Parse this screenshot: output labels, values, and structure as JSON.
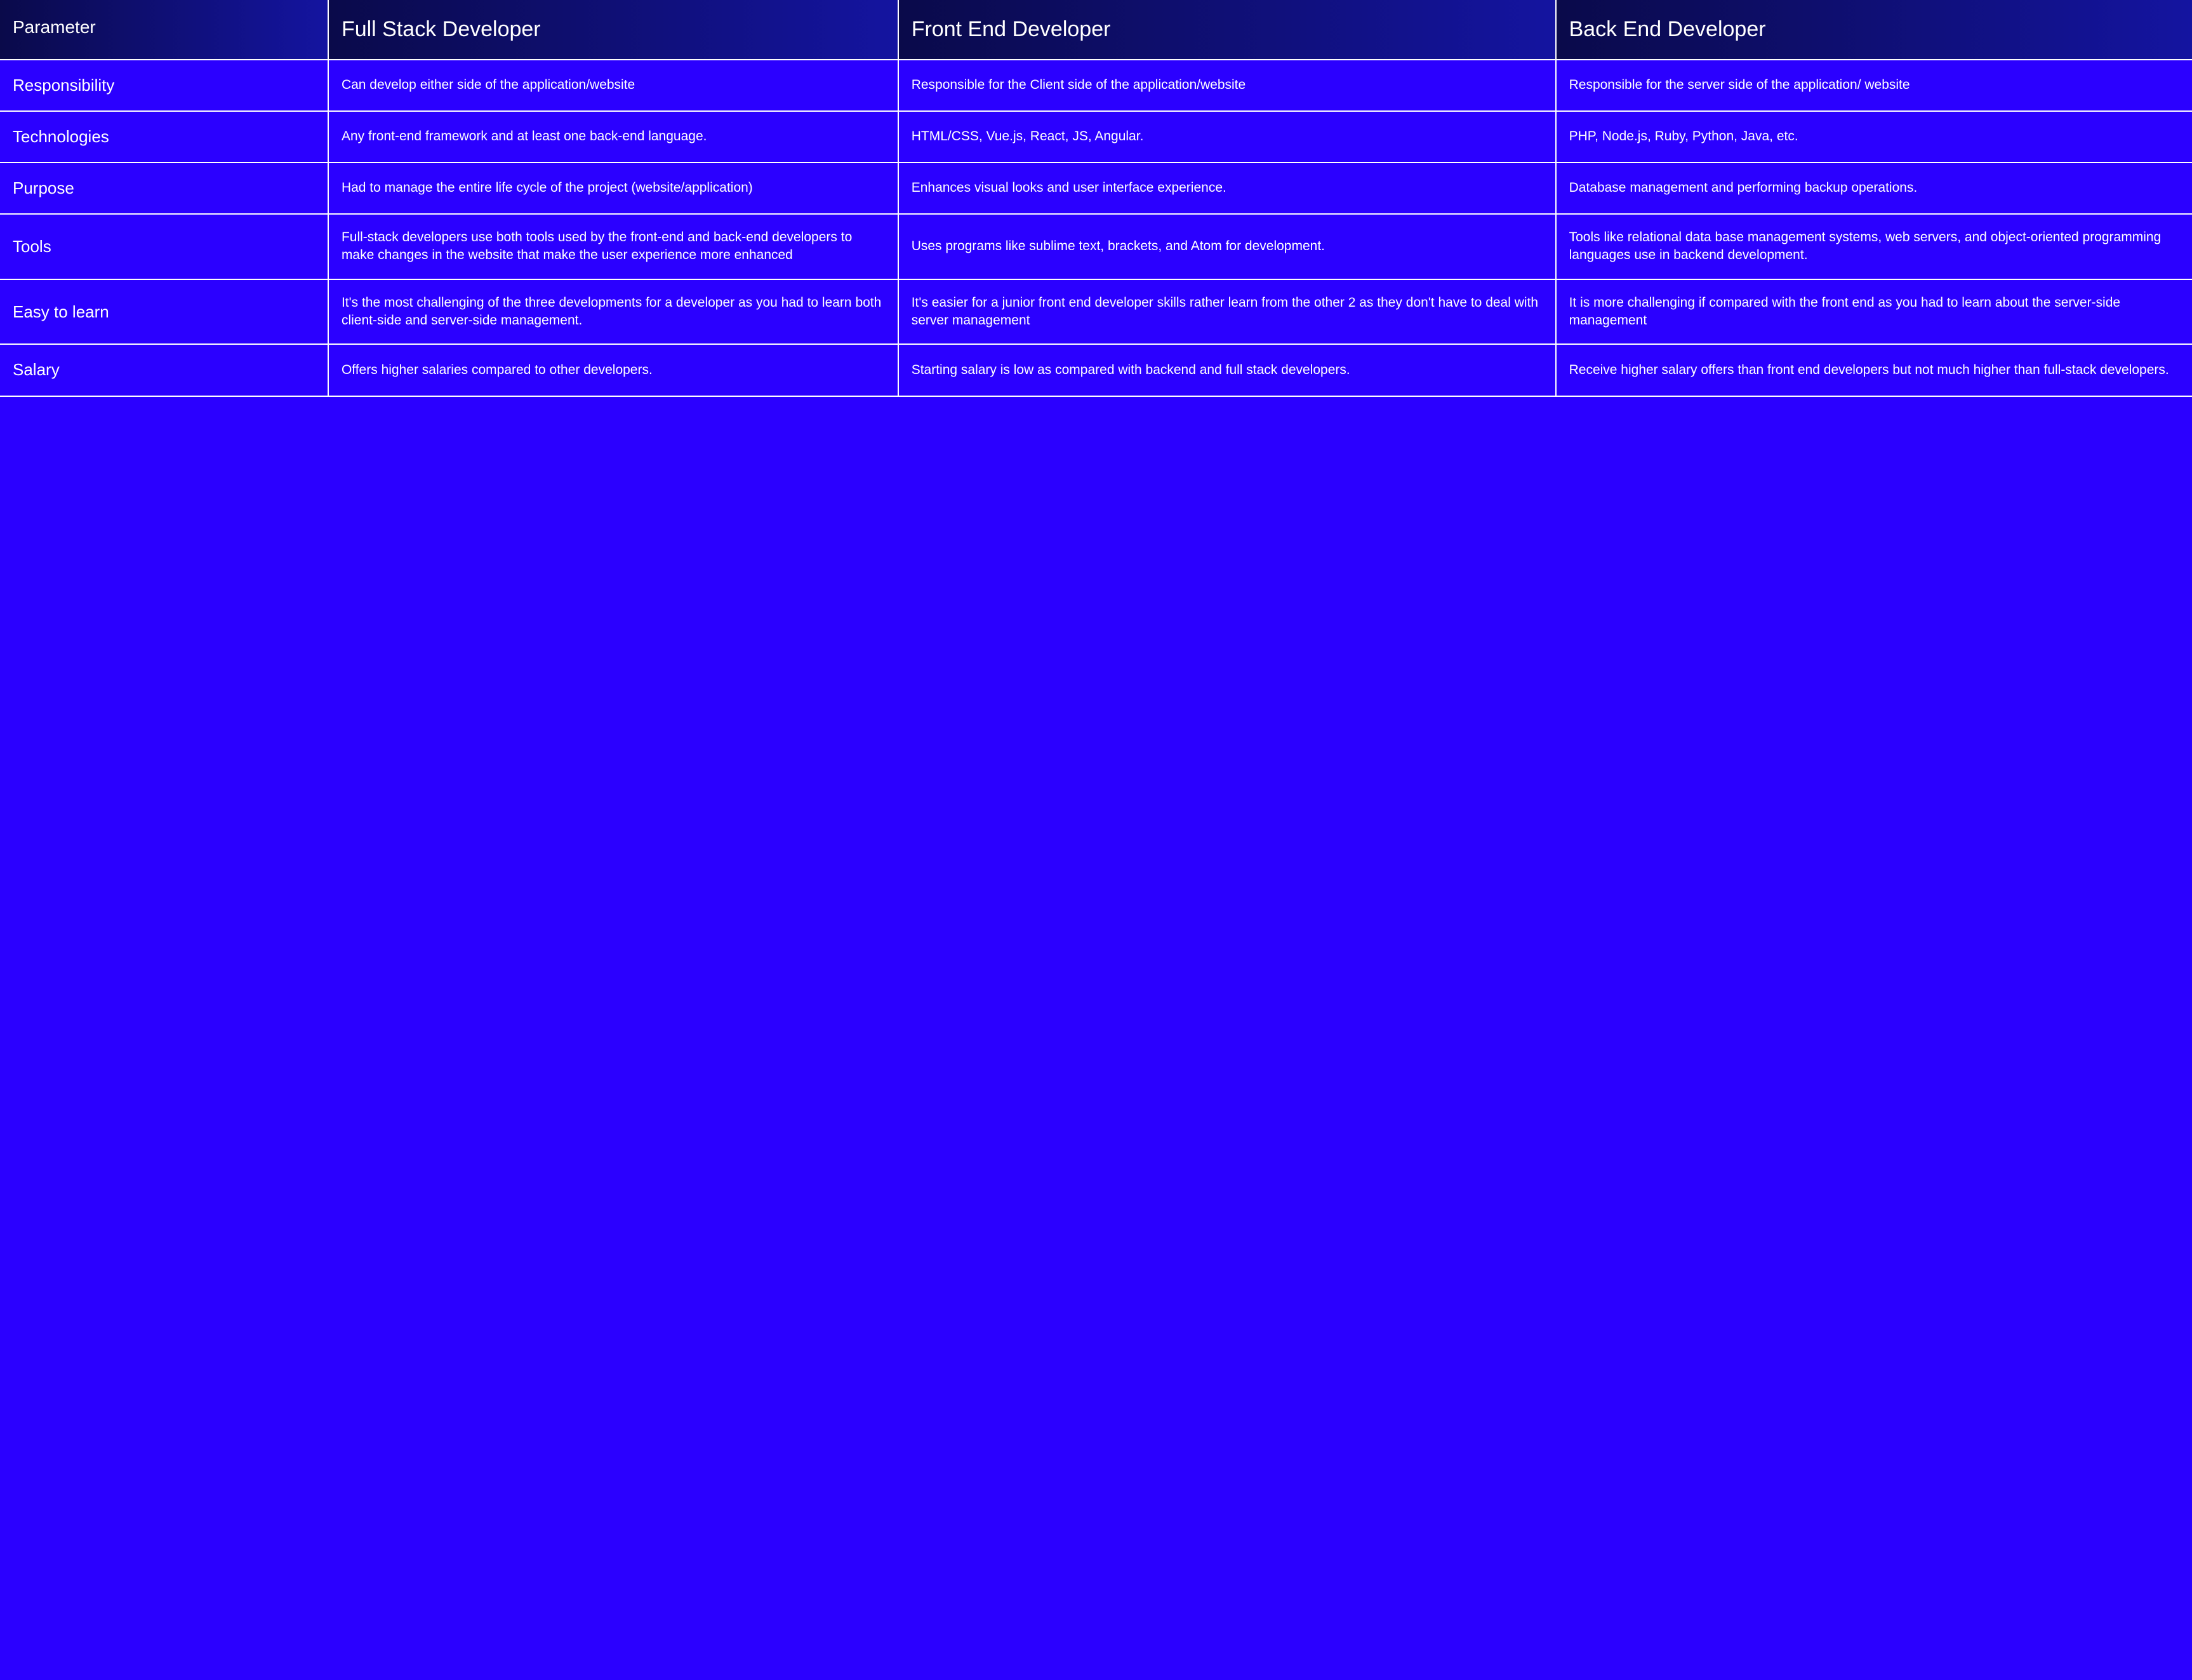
{
  "chart_data": {
    "type": "table",
    "columns": [
      "Parameter",
      "Full Stack Developer",
      "Front End Developer",
      "Back End Developer"
    ],
    "rows": [
      [
        "Responsibility",
        "Can develop either side of the application/website",
        "Responsible for the Client side of the application/website",
        "Responsible for the server side of the application/ website"
      ],
      [
        "Technologies",
        "Any front-end framework and at least one back-end language.",
        "HTML/CSS, Vue.js, React, JS, Angular.",
        "PHP, Node.js, Ruby, Python, Java, etc."
      ],
      [
        "Purpose",
        "Had to manage the entire life cycle of the project (website/application)",
        "Enhances visual looks and user interface experience.",
        "Database management and performing backup operations."
      ],
      [
        "Tools",
        "Full-stack developers use both tools used by the front-end and back-end developers to make changes in the website that make the user experience more enhanced",
        "Uses programs like sublime text, brackets, and Atom for development.",
        "Tools like relational data base management systems, web servers, and object-oriented programming languages use in backend development."
      ],
      [
        "Easy to learn",
        "It's the most challenging of the three developments  for a developer as you had to learn both client-side and server-side management.",
        "It's easier for a junior front end developer skills rather learn from the other 2 as they don't have to deal with server management",
        "It is more challenging if compared with the front end as you had to learn about the server-side management"
      ],
      [
        "Salary",
        "Offers higher salaries compared to other developers.",
        "Starting salary is low as compared with backend and full stack developers.",
        "Receive higher salary offers than front end developers but not much higher than full-stack developers."
      ]
    ]
  },
  "headers": {
    "c0": "Parameter",
    "c1": "Full Stack Developer",
    "c2": "Front End Developer",
    "c3": "Back End Developer"
  },
  "rows": {
    "r0": {
      "label": "Responsibility",
      "c1": "Can develop either side of the application/website",
      "c2": "Responsible for the Client side of the application/website",
      "c3": "Responsible for the server side of the application/ website"
    },
    "r1": {
      "label": "Technologies",
      "c1": "Any front-end framework and at least one back-end language.",
      "c2": "HTML/CSS, Vue.js, React, JS, Angular.",
      "c3": "PHP, Node.js, Ruby, Python, Java, etc."
    },
    "r2": {
      "label": "Purpose",
      "c1": "Had to manage the entire life cycle of the project (website/application)",
      "c2": "Enhances visual looks and user interface experience.",
      "c3": "Database management and performing backup operations."
    },
    "r3": {
      "label": "Tools",
      "c1": "Full-stack developers use both tools used by the front-end and back-end developers to make changes in the website that make the user experience more enhanced",
      "c2": "Uses programs like sublime text, brackets, and Atom for development.",
      "c3": "Tools like relational data base management systems, web servers, and object-oriented programming languages use in backend development."
    },
    "r4": {
      "label": "Easy to learn",
      "c1": "It's the most challenging of the three developments  for a developer as you had to learn both client-side and server-side management.",
      "c2": "It's easier for a junior front end developer skills rather learn from the other 2 as they don't have to deal with server management",
      "c3": "It is more challenging if compared with the front end as you had to learn about the server-side management"
    },
    "r5": {
      "label": "Salary",
      "c1": "Offers higher salaries compared to other developers.",
      "c2": "Starting salary is low as compared with backend and full stack developers.",
      "c3": "Receive higher salary offers than front end developers but not much higher than full-stack developers."
    }
  }
}
